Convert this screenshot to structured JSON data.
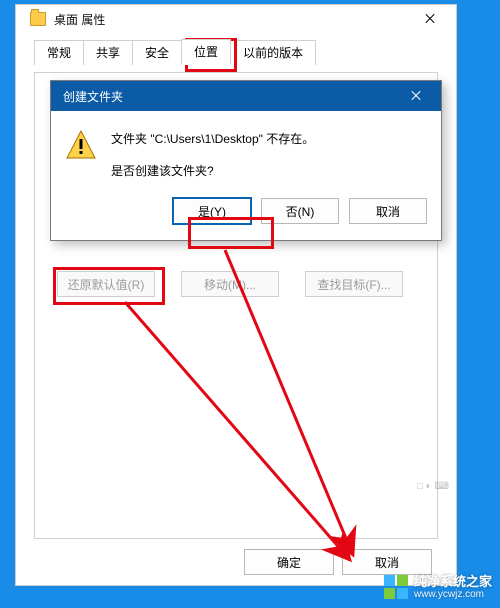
{
  "window": {
    "title": "桌面 属性",
    "tabs": [
      "常规",
      "共享",
      "安全",
      "位置",
      "以前的版本"
    ],
    "active_tab_index": 3,
    "lower_buttons": {
      "restore": "还原默认值(R)",
      "move": "移动(M)...",
      "find": "查找目标(F)..."
    },
    "bottom": {
      "ok": "确定",
      "cancel": "取消"
    }
  },
  "modal": {
    "title": "创建文件夹",
    "line1": "文件夹 \"C:\\Users\\1\\Desktop\" 不存在。",
    "line2": "是否创建该文件夹?",
    "yes": "是(Y)",
    "no": "否(N)",
    "cancel": "取消"
  },
  "watermark": {
    "name": "纯净系统之家",
    "url": "www.ycwjz.com"
  }
}
